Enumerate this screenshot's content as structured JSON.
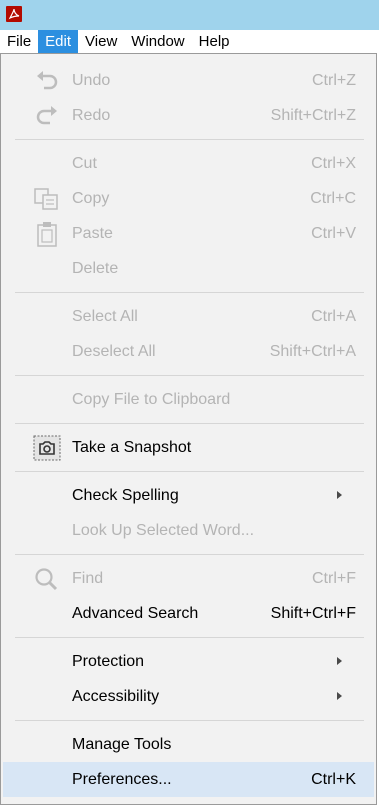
{
  "menubar": {
    "items": [
      "File",
      "Edit",
      "View",
      "Window",
      "Help"
    ],
    "active": "Edit"
  },
  "menu": {
    "undo": {
      "label": "Undo",
      "shortcut": "Ctrl+Z"
    },
    "redo": {
      "label": "Redo",
      "shortcut": "Shift+Ctrl+Z"
    },
    "cut": {
      "label": "Cut",
      "shortcut": "Ctrl+X"
    },
    "copy": {
      "label": "Copy",
      "shortcut": "Ctrl+C"
    },
    "paste": {
      "label": "Paste",
      "shortcut": "Ctrl+V"
    },
    "delete": {
      "label": "Delete",
      "shortcut": ""
    },
    "select_all": {
      "label": "Select All",
      "shortcut": "Ctrl+A"
    },
    "deselect_all": {
      "label": "Deselect All",
      "shortcut": "Shift+Ctrl+A"
    },
    "copy_file": {
      "label": "Copy File to Clipboard",
      "shortcut": ""
    },
    "snapshot": {
      "label": "Take a Snapshot",
      "shortcut": ""
    },
    "check_spelling": {
      "label": "Check Spelling",
      "shortcut": ""
    },
    "look_up": {
      "label": "Look Up Selected Word...",
      "shortcut": ""
    },
    "find": {
      "label": "Find",
      "shortcut": "Ctrl+F"
    },
    "advanced_search": {
      "label": "Advanced Search",
      "shortcut": "Shift+Ctrl+F"
    },
    "protection": {
      "label": "Protection",
      "shortcut": ""
    },
    "accessibility": {
      "label": "Accessibility",
      "shortcut": ""
    },
    "manage_tools": {
      "label": "Manage Tools",
      "shortcut": ""
    },
    "preferences": {
      "label": "Preferences...",
      "shortcut": "Ctrl+K"
    }
  },
  "colors": {
    "titlebar": "#9fd3ec",
    "active_menu": "#2c8fe0",
    "hover_row": "#d8e6f5",
    "disabled_text": "#b4b4b4"
  }
}
